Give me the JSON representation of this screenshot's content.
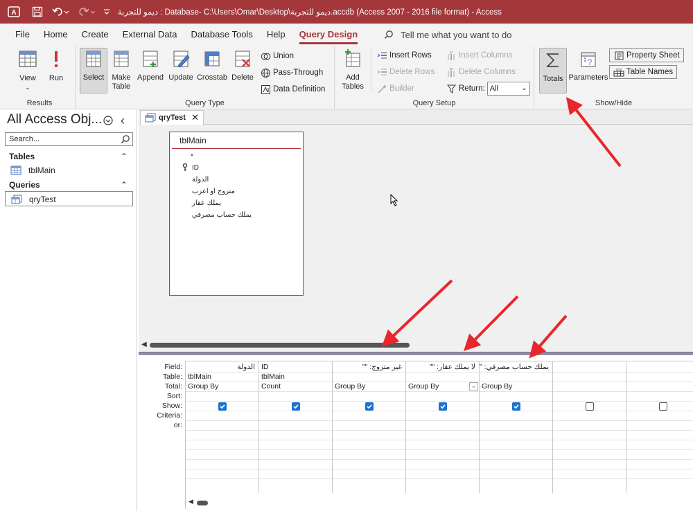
{
  "titlebar": {
    "title": "ديمو للتجربة : Database- C:\\Users\\Omar\\Desktop\\ديمو للتجربة.accdb (Access 2007 - 2016 file format)  -  Access",
    "bg_color": "#a4373a"
  },
  "menu": {
    "items": [
      {
        "label": "File"
      },
      {
        "label": "Home"
      },
      {
        "label": "Create"
      },
      {
        "label": "External Data"
      },
      {
        "label": "Database Tools"
      },
      {
        "label": "Help"
      },
      {
        "label": "Query Design"
      }
    ],
    "active_index": 6,
    "tellme": "Tell me what you want to do"
  },
  "ribbon": {
    "results": {
      "label": "Results",
      "view": "View",
      "run": "Run"
    },
    "query_type": {
      "label": "Query Type",
      "select": "Select",
      "make_table_1": "Make",
      "make_table_2": "Table",
      "append": "Append",
      "update": "Update",
      "crosstab": "Crosstab",
      "delete": "Delete",
      "union": "Union",
      "pass_through": "Pass-Through",
      "data_definition": "Data Definition"
    },
    "query_setup": {
      "label": "Query Setup",
      "add_tables_1": "Add",
      "add_tables_2": "Tables",
      "insert_rows": "Insert Rows",
      "delete_rows": "Delete Rows",
      "builder": "Builder",
      "insert_columns": "Insert Columns",
      "delete_columns": "Delete Columns",
      "return_label": "Return:",
      "return_value": "All"
    },
    "show_hide": {
      "label": "Show/Hide",
      "totals": "Totals",
      "parameters": "Parameters",
      "property_sheet": "Property Sheet",
      "table_names": "Table Names"
    }
  },
  "nav": {
    "title": "All Access Obj...",
    "search_placeholder": "Search...",
    "groups": [
      {
        "label": "Tables",
        "items": [
          "tblMain"
        ]
      },
      {
        "label": "Queries",
        "items": [
          "qryTest"
        ]
      }
    ]
  },
  "document": {
    "tab_label": "qryTest"
  },
  "table_box": {
    "title": "tblMain",
    "fields": [
      "*",
      "ID",
      "الدولة",
      "متزوج او اعزب",
      "يملك عقار",
      "يملك حساب مصرفي"
    ]
  },
  "design_grid": {
    "row_labels": [
      "Field:",
      "Table:",
      "Total:",
      "Sort:",
      "Show:",
      "Criteria:",
      "or:"
    ],
    "columns": [
      {
        "field": "الدولة",
        "table": "tblMain",
        "total": "Group By",
        "show": true
      },
      {
        "field": "ID",
        "table": "tblMain",
        "total": "Count",
        "show": true
      },
      {
        "field": "غير متزوج: \"\"",
        "table": "",
        "total": "Group By",
        "show": true
      },
      {
        "field": "لا يملك عقار: \"\"",
        "table": "",
        "total": "Group By",
        "show": true
      },
      {
        "field": "يملك حساب مصرفي: \"\"",
        "table": "",
        "total": "Group By",
        "show": true
      },
      {
        "field": "",
        "table": "",
        "total": "",
        "show": false
      },
      {
        "field": "",
        "table": "",
        "total": "",
        "show": false
      }
    ]
  },
  "colors": {
    "accent": "#a4373a",
    "checkbox": "#1a73d0",
    "annotation_arrow": "#e8262b"
  }
}
